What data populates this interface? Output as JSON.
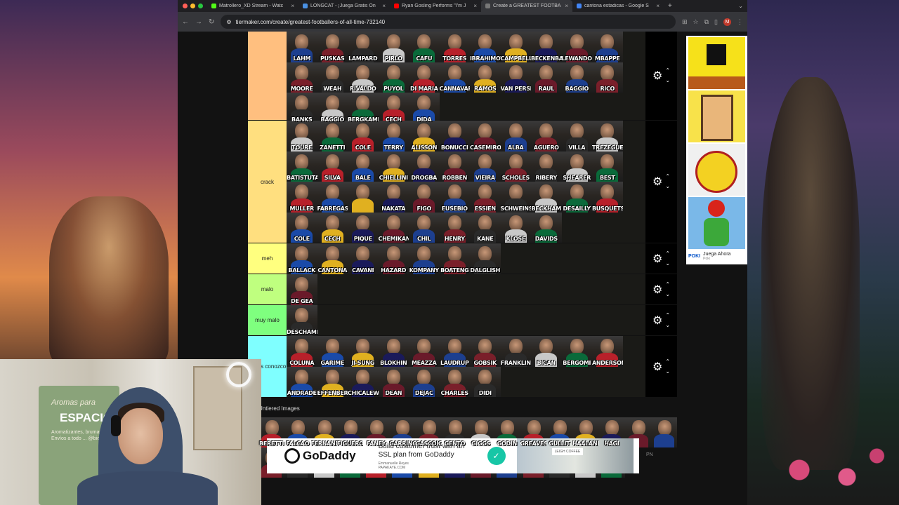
{
  "browser": {
    "tabs": [
      {
        "label": "Matrollero_XD Stream - Watc",
        "favicon_color": "#53fc18",
        "active": false
      },
      {
        "label": "LONGCAT - ¡Juega Gratis On",
        "favicon_color": "#4a90e2",
        "active": false
      },
      {
        "label": "Ryan Gosling Performs \"I'm J",
        "favicon_color": "#ff0000",
        "active": false
      },
      {
        "label": "Create a GREATEST FOOTBA",
        "favicon_color": "#777777",
        "active": true
      },
      {
        "label": "cantona estadicas - Google S",
        "favicon_color": "#4285f4",
        "active": false
      }
    ],
    "new_tab": "+",
    "url": "tiermaker.com/create/greatest-footballers-of-all-time-732140",
    "profile_initial": "M"
  },
  "tiers": [
    {
      "label": "",
      "color": "#ffbf7f",
      "players": [
        "LAHM",
        "PUSKAS",
        "LAMPARD",
        "PIRLO",
        "CAFU",
        "TORRES",
        "IBRAHIMOVIC",
        "CAMPBELL",
        "BECKENBAUER",
        "LEWANDOWSKI",
        "MBAPPE",
        "MOORE",
        "WEAH",
        "RIVALDO",
        "PUYOL",
        "DI MARIA",
        "CANNAVARO",
        "RAMOS",
        "VAN PERSIE",
        "RAUL",
        "BAGGIO",
        "RICO",
        "BANKS",
        "BAGGIO",
        "BERGKAMP",
        "CECH",
        "DIDA"
      ]
    },
    {
      "label": "crack",
      "color": "#ffdf7f",
      "players": [
        "TOURE",
        "ZANETTI",
        "COLE",
        "TERRY",
        "ALISSON",
        "BONUCCI",
        "CASEMIRO",
        "ALBA",
        "AGUERO",
        "VILLA",
        "TREZEGUET",
        "BATISTUTA",
        "SILVA",
        "BALE",
        "CHIELLINI",
        "DROGBA",
        "ROBBEN",
        "VIEIRA",
        "SCHOLES",
        "RIBERY",
        "SHEARER",
        "BEST",
        "MULLER",
        "FABREGAS",
        "",
        "NAKATA",
        "FIGO",
        "EUSEBIO",
        "ESSIEN",
        "SCHWEINSTEIGER",
        "BECKHAM",
        "DESAILLY",
        "BUSQUETS",
        "COLE",
        "CECH",
        "PIQUE",
        "CHEMIKAN",
        "CHIL",
        "HENRY",
        "KANE",
        "KLOSE",
        "DAVIDS"
      ]
    },
    {
      "label": "meh",
      "color": "#ffff7f",
      "players": [
        "BALLACK",
        "CANTONA",
        "CAVANI",
        "HAZARD",
        "KOMPANY",
        "BOATENG",
        "DALGLISH"
      ]
    },
    {
      "label": "malo",
      "color": "#bfff7f",
      "players": [
        "DE GEA"
      ]
    },
    {
      "label": "muy malo",
      "color": "#7fff7f",
      "players": [
        "DESCHAMPS"
      ]
    },
    {
      "label": "no los conozco",
      "color": "#7fffff",
      "players": [
        "COLUNA",
        "GARIME",
        "JI-SUNG",
        "BLOKHIN",
        "MEAZZA",
        "LAUDRUP",
        "GOBSIK",
        "FRANKLIN",
        "BICAN",
        "BERGOMI",
        "ANDERSON",
        "ANDRADE",
        "EFFENBERG",
        "CHICALEWT",
        "DEAN",
        "DEJAC",
        "CHARLES",
        "DIDI"
      ]
    }
  ],
  "untiered": {
    "title": "Untiered Images",
    "players": [
      "BERETTI",
      "FALCAO",
      "FERNANDO",
      "FIGUEROA",
      "FANEY",
      "GARRINCHA",
      "GASCOIGNE",
      "GENTO",
      "GIGGS",
      "GODIN",
      "GREAVES",
      "GULLIT",
      "HAALAND",
      "HAGI",
      "",
      "",
      "",
      "",
      "",
      "",
      "",
      "",
      "",
      "",
      "",
      "",
      "",
      "",
      "",
      ""
    ]
  },
  "side_ad": {
    "label": "Juega Ahora",
    "sub": "Poki",
    "logo": "POKI"
  },
  "bottom_ad": {
    "brand": "GoDaddy",
    "headline": "Build customer trust with an SSL plan from GoDaddy",
    "byline": "Emmanuelle Reyes",
    "byline2": "PAPAKAYE.COM",
    "photo_label": "LEIGH COFFEE",
    "pn": "PN"
  },
  "webcam": {
    "poster_line1": "Aromas para",
    "poster_line2": "ESPACIO",
    "poster_line3": "Aromatizantes, brumas y ... Envíos a todo ... @biogreen"
  },
  "colors": {
    "kits": [
      "#1d3f8f",
      "#7a1f2a",
      "#2a2a2a",
      "#c8c8c8",
      "#0a6a3a",
      "#b8202a",
      "#1a4aa8",
      "#e0b020",
      "#1a1a5a",
      "#6a1a2a"
    ]
  }
}
